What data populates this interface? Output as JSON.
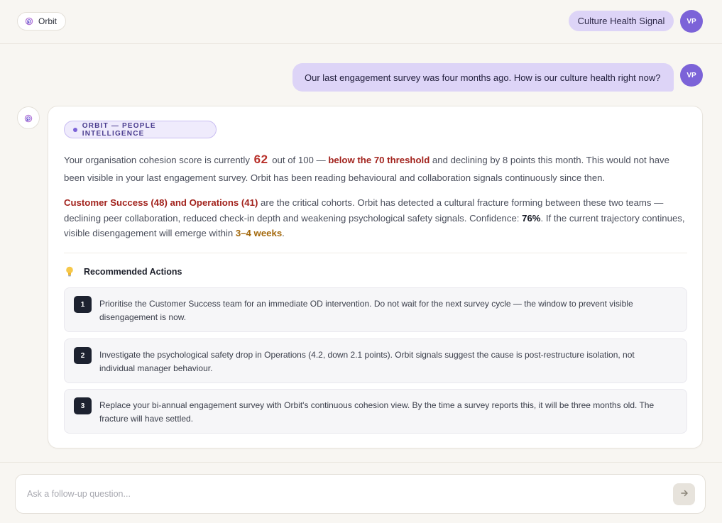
{
  "header": {
    "brand_label": "Orbit",
    "signal_label": "Culture Health Signal",
    "user_initials": "VP"
  },
  "conversation": {
    "user_message": "Our last engagement survey was four months ago. How is our culture health right now?",
    "user_initials": "VP",
    "response": {
      "source_label": "ORBIT — PEOPLE INTELLIGENCE",
      "summary": {
        "part1": "Your organisation cohesion score is currently ",
        "score": "62",
        "part2": " out of 100 — ",
        "threshold": "below the 70 threshold",
        "part3": " and declining by 8 points this month. This would not have been visible in your last engagement survey. Orbit has been reading behavioural and collaboration signals continuously since then."
      },
      "detail": {
        "cohorts": "Customer Success (48) and Operations (41)",
        "part1": " are the critical cohorts. Orbit has detected a cultural fracture forming between these two teams — declining peer collaboration, reduced check-in depth and weakening psychological safety signals. Confidence: ",
        "confidence": "76%",
        "part2": ". If the current trajectory continues, visible disengagement will emerge within ",
        "timeframe": "3–4 weeks",
        "part3": "."
      },
      "recommendations": {
        "heading": "Recommended Actions",
        "items": [
          {
            "number": "1",
            "text": "Prioritise the Customer Success team for an immediate OD intervention. Do not wait for the next survey cycle — the window to prevent visible disengagement is now."
          },
          {
            "number": "2",
            "text": "Investigate the psychological safety drop in Operations (4.2, down 2.1 points). Orbit signals suggest the cause is post-restructure isolation, not individual manager behaviour."
          },
          {
            "number": "3",
            "text": "Replace your bi-annual engagement survey with Orbit's continuous cohesion view. By the time a survey reports this, it will be three months old. The fracture will have settled."
          }
        ]
      }
    }
  },
  "composer": {
    "placeholder": "Ask a follow-up question...",
    "value": ""
  },
  "icons": {
    "brand": "orbit-logo-icon",
    "bulb": "lightbulb-icon",
    "send": "arrow-right-icon"
  },
  "colors": {
    "accent": "#7c63d8",
    "accent_soft": "#ddd4f7",
    "alert": "#a2231d",
    "warning": "#a3680b",
    "background": "#f8f6f2"
  }
}
